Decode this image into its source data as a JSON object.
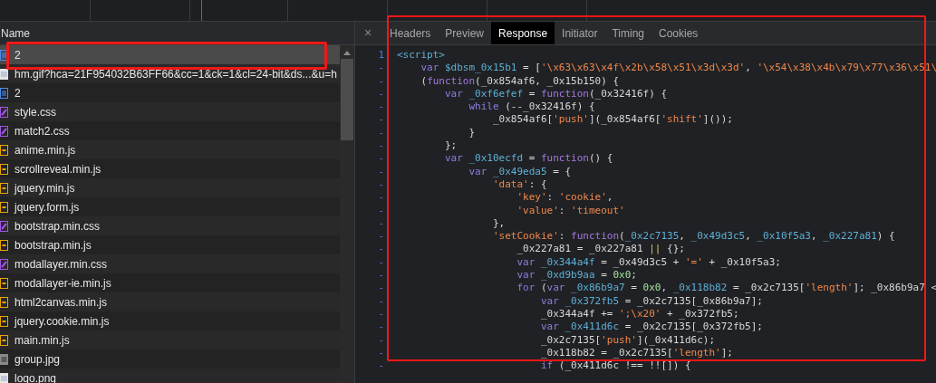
{
  "requests": {
    "column_header": "Name",
    "rows": [
      {
        "name": "2",
        "kind": "doc",
        "selected": true
      },
      {
        "name": "hm.gif?hca=21F954032B63FF66&cc=1&ck=1&cl=24-bit&ds...&u=h",
        "kind": "image",
        "selected": false
      },
      {
        "name": "2",
        "kind": "doc",
        "selected": false
      },
      {
        "name": "style.css",
        "kind": "css",
        "selected": false
      },
      {
        "name": "match2.css",
        "kind": "css",
        "selected": false
      },
      {
        "name": "anime.min.js",
        "kind": "js",
        "selected": false
      },
      {
        "name": "scrollreveal.min.js",
        "kind": "js",
        "selected": false
      },
      {
        "name": "jquery.min.js",
        "kind": "js",
        "selected": false
      },
      {
        "name": "jquery.form.js",
        "kind": "js",
        "selected": false
      },
      {
        "name": "bootstrap.min.css",
        "kind": "css",
        "selected": false
      },
      {
        "name": "bootstrap.min.js",
        "kind": "js",
        "selected": false
      },
      {
        "name": "modallayer.min.css",
        "kind": "css",
        "selected": false
      },
      {
        "name": "modallayer-ie.min.js",
        "kind": "js",
        "selected": false
      },
      {
        "name": "html2canvas.min.js",
        "kind": "js",
        "selected": false
      },
      {
        "name": "jquery.cookie.min.js",
        "kind": "js",
        "selected": false
      },
      {
        "name": "main.min.js",
        "kind": "js",
        "selected": false
      },
      {
        "name": "group.jpg",
        "kind": "photo",
        "selected": false
      },
      {
        "name": "logo.png",
        "kind": "image",
        "selected": false
      }
    ]
  },
  "detail": {
    "close": "×",
    "tabs": [
      {
        "label": "Headers",
        "selected": false
      },
      {
        "label": "Preview",
        "selected": false
      },
      {
        "label": "Response",
        "selected": true
      },
      {
        "label": "Initiator",
        "selected": false
      },
      {
        "label": "Timing",
        "selected": false
      },
      {
        "label": "Cookies",
        "selected": false
      }
    ],
    "code_lines": [
      {
        "gutter": "1",
        "tokens": [
          {
            "kind": "tag",
            "text": "<script>"
          }
        ]
      },
      {
        "gutter": "-",
        "tokens": [
          {
            "kind": "kw",
            "text": "    var"
          },
          {
            "kind": "def",
            "text": " $dbsm_0x15b1"
          },
          {
            "kind": "p",
            "text": " = ["
          },
          {
            "kind": "str",
            "text": "'\\x63\\x63\\x4f\\x2b\\x58\\x51\\x3d\\x3d'"
          },
          {
            "kind": "p",
            "text": ", "
          },
          {
            "kind": "str",
            "text": "'\\x54\\x38\\x4b\\x79\\x77\\x36\\x51\\"
          }
        ]
      },
      {
        "gutter": "-",
        "tokens": [
          {
            "kind": "p",
            "text": "    ("
          },
          {
            "kind": "fn",
            "text": "function"
          },
          {
            "kind": "p",
            "text": "(_0x854af6, _0x15b150) {"
          }
        ]
      },
      {
        "gutter": "-",
        "tokens": [
          {
            "kind": "kw",
            "text": "        var"
          },
          {
            "kind": "def",
            "text": " _0xf6efef"
          },
          {
            "kind": "p",
            "text": " = "
          },
          {
            "kind": "fn",
            "text": "function"
          },
          {
            "kind": "p",
            "text": "(_0x32416f) {"
          }
        ]
      },
      {
        "gutter": "-",
        "tokens": [
          {
            "kind": "kw",
            "text": "            while"
          },
          {
            "kind": "p",
            "text": " (--_0x32416f) {"
          }
        ]
      },
      {
        "gutter": "-",
        "tokens": [
          {
            "kind": "p",
            "text": "                _0x854af6["
          },
          {
            "kind": "str",
            "text": "'push'"
          },
          {
            "kind": "p",
            "text": "](_0x854af6["
          },
          {
            "kind": "str",
            "text": "'shift'"
          },
          {
            "kind": "p",
            "text": "]());"
          }
        ]
      },
      {
        "gutter": "-",
        "tokens": [
          {
            "kind": "p",
            "text": "            }"
          }
        ]
      },
      {
        "gutter": "-",
        "tokens": [
          {
            "kind": "p",
            "text": "        };"
          }
        ]
      },
      {
        "gutter": "-",
        "tokens": [
          {
            "kind": "kw",
            "text": "        var"
          },
          {
            "kind": "def",
            "text": " _0x10ecfd"
          },
          {
            "kind": "p",
            "text": " = "
          },
          {
            "kind": "fn",
            "text": "function"
          },
          {
            "kind": "p",
            "text": "() {"
          }
        ]
      },
      {
        "gutter": "-",
        "tokens": [
          {
            "kind": "kw",
            "text": "            var"
          },
          {
            "kind": "def",
            "text": " _0x49eda5"
          },
          {
            "kind": "p",
            "text": " = {"
          }
        ]
      },
      {
        "gutter": "-",
        "tokens": [
          {
            "kind": "str",
            "text": "                'data'"
          },
          {
            "kind": "p",
            "text": ": {"
          }
        ]
      },
      {
        "gutter": "-",
        "tokens": [
          {
            "kind": "str",
            "text": "                    'key'"
          },
          {
            "kind": "p",
            "text": ": "
          },
          {
            "kind": "str",
            "text": "'cookie'"
          },
          {
            "kind": "p",
            "text": ","
          }
        ]
      },
      {
        "gutter": "-",
        "tokens": [
          {
            "kind": "str",
            "text": "                    'value'"
          },
          {
            "kind": "p",
            "text": ": "
          },
          {
            "kind": "str",
            "text": "'timeout'"
          }
        ]
      },
      {
        "gutter": "-",
        "tokens": [
          {
            "kind": "p",
            "text": "                },"
          }
        ]
      },
      {
        "gutter": "-",
        "tokens": [
          {
            "kind": "str",
            "text": "                'setCookie'"
          },
          {
            "kind": "p",
            "text": ": "
          },
          {
            "kind": "fn",
            "text": "function"
          },
          {
            "kind": "p",
            "text": "("
          },
          {
            "kind": "def",
            "text": "_0x2c7135"
          },
          {
            "kind": "p",
            "text": ", "
          },
          {
            "kind": "def",
            "text": "_0x49d3c5"
          },
          {
            "kind": "p",
            "text": ", "
          },
          {
            "kind": "def",
            "text": "_0x10f5a3"
          },
          {
            "kind": "p",
            "text": ", "
          },
          {
            "kind": "def",
            "text": "_0x227a81"
          },
          {
            "kind": "p",
            "text": ") {"
          }
        ]
      },
      {
        "gutter": "-",
        "tokens": [
          {
            "kind": "p",
            "text": "                    _0x227a81 = _0x227a81 "
          },
          {
            "kind": "op",
            "text": "||"
          },
          {
            "kind": "p",
            "text": " {};"
          }
        ]
      },
      {
        "gutter": "-",
        "tokens": [
          {
            "kind": "kw",
            "text": "                    var"
          },
          {
            "kind": "def",
            "text": " _0x344a4f"
          },
          {
            "kind": "p",
            "text": " = _0x49d3c5 + "
          },
          {
            "kind": "str",
            "text": "'='"
          },
          {
            "kind": "p",
            "text": " + _0x10f5a3;"
          }
        ]
      },
      {
        "gutter": "-",
        "tokens": [
          {
            "kind": "kw",
            "text": "                    var"
          },
          {
            "kind": "def",
            "text": " _0xd9b9aa"
          },
          {
            "kind": "p",
            "text": " = "
          },
          {
            "kind": "num",
            "text": "0x0"
          },
          {
            "kind": "p",
            "text": ";"
          }
        ]
      },
      {
        "gutter": "-",
        "tokens": [
          {
            "kind": "kw",
            "text": "                    for"
          },
          {
            "kind": "p",
            "text": " ("
          },
          {
            "kind": "kw",
            "text": "var"
          },
          {
            "kind": "def",
            "text": " _0x86b9a7"
          },
          {
            "kind": "p",
            "text": " = "
          },
          {
            "kind": "num",
            "text": "0x0"
          },
          {
            "kind": "p",
            "text": ", "
          },
          {
            "kind": "def",
            "text": "_0x118b82"
          },
          {
            "kind": "p",
            "text": " = _0x2c7135["
          },
          {
            "kind": "str",
            "text": "'length'"
          },
          {
            "kind": "p",
            "text": "]; _0x86b9a7 <"
          }
        ]
      },
      {
        "gutter": "-",
        "tokens": [
          {
            "kind": "kw",
            "text": "                        var"
          },
          {
            "kind": "def",
            "text": " _0x372fb5"
          },
          {
            "kind": "p",
            "text": " = _0x2c7135[_0x86b9a7];"
          }
        ]
      },
      {
        "gutter": "-",
        "tokens": [
          {
            "kind": "p",
            "text": "                        _0x344a4f += "
          },
          {
            "kind": "str",
            "text": "';\\x20'"
          },
          {
            "kind": "p",
            "text": " + _0x372fb5;"
          }
        ]
      },
      {
        "gutter": "-",
        "tokens": [
          {
            "kind": "kw",
            "text": "                        var"
          },
          {
            "kind": "def",
            "text": " _0x411d6c"
          },
          {
            "kind": "p",
            "text": " = _0x2c7135[_0x372fb5];"
          }
        ]
      },
      {
        "gutter": "-",
        "tokens": [
          {
            "kind": "p",
            "text": "                        _0x2c7135["
          },
          {
            "kind": "str",
            "text": "'push'"
          },
          {
            "kind": "p",
            "text": "](_0x411d6c);"
          }
        ]
      },
      {
        "gutter": "-",
        "tokens": [
          {
            "kind": "p",
            "text": "                        _0x118b82 = _0x2c7135["
          },
          {
            "kind": "str",
            "text": "'length'"
          },
          {
            "kind": "p",
            "text": "];"
          }
        ]
      },
      {
        "gutter": "-",
        "tokens": [
          {
            "kind": "kw",
            "text": "                        if"
          },
          {
            "kind": "p",
            "text": " (_0x411d6c !== !![]) {"
          }
        ]
      }
    ]
  }
}
